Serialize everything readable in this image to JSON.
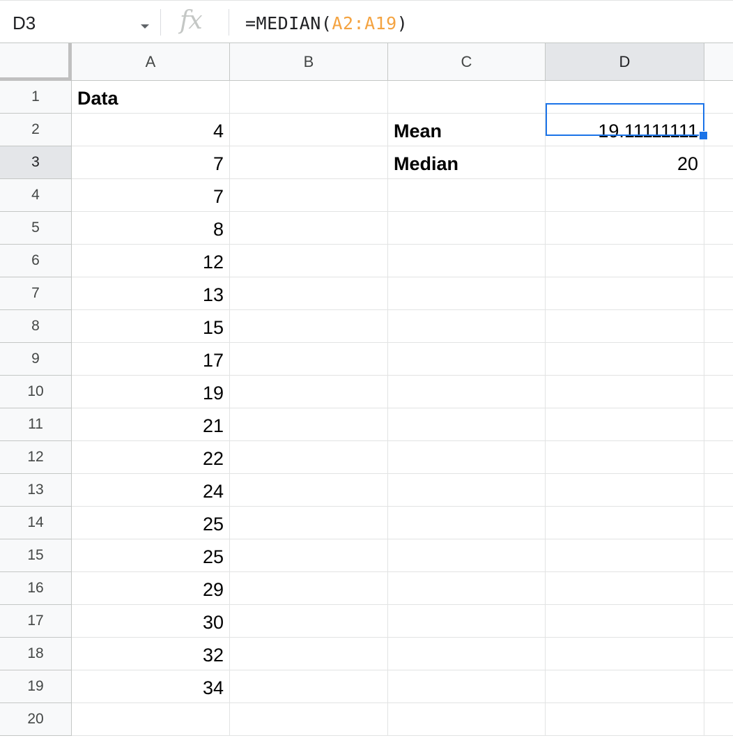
{
  "formula_bar": {
    "name_box": "D3",
    "fx_icon": "function-fx-icon",
    "formula_prefix": "=MEDIAN(",
    "formula_range": "A2:A19",
    "formula_suffix": ")"
  },
  "columns": [
    "A",
    "B",
    "C",
    "D"
  ],
  "active_column": "D",
  "active_row": 3,
  "rows": [
    {
      "row": "1",
      "A": "Data",
      "B": "",
      "C": "",
      "D": ""
    },
    {
      "row": "2",
      "A": "4",
      "B": "",
      "C": "Mean",
      "D": "19.11111111"
    },
    {
      "row": "3",
      "A": "7",
      "B": "",
      "C": "Median",
      "D": "20"
    },
    {
      "row": "4",
      "A": "7",
      "B": "",
      "C": "",
      "D": ""
    },
    {
      "row": "5",
      "A": "8",
      "B": "",
      "C": "",
      "D": ""
    },
    {
      "row": "6",
      "A": "12",
      "B": "",
      "C": "",
      "D": ""
    },
    {
      "row": "7",
      "A": "13",
      "B": "",
      "C": "",
      "D": ""
    },
    {
      "row": "8",
      "A": "15",
      "B": "",
      "C": "",
      "D": ""
    },
    {
      "row": "9",
      "A": "17",
      "B": "",
      "C": "",
      "D": ""
    },
    {
      "row": "10",
      "A": "19",
      "B": "",
      "C": "",
      "D": ""
    },
    {
      "row": "11",
      "A": "21",
      "B": "",
      "C": "",
      "D": ""
    },
    {
      "row": "12",
      "A": "22",
      "B": "",
      "C": "",
      "D": ""
    },
    {
      "row": "13",
      "A": "24",
      "B": "",
      "C": "",
      "D": ""
    },
    {
      "row": "14",
      "A": "25",
      "B": "",
      "C": "",
      "D": ""
    },
    {
      "row": "15",
      "A": "25",
      "B": "",
      "C": "",
      "D": ""
    },
    {
      "row": "16",
      "A": "29",
      "B": "",
      "C": "",
      "D": ""
    },
    {
      "row": "17",
      "A": "30",
      "B": "",
      "C": "",
      "D": ""
    },
    {
      "row": "18",
      "A": "32",
      "B": "",
      "C": "",
      "D": ""
    },
    {
      "row": "19",
      "A": "34",
      "B": "",
      "C": "",
      "D": ""
    },
    {
      "row": "20",
      "A": "",
      "B": "",
      "C": "",
      "D": ""
    }
  ],
  "colors": {
    "selection": "#1a73e8",
    "formula_range": "#f4a341",
    "header_bg": "#f8f9fa",
    "active_header_bg": "#e4e6e9"
  }
}
